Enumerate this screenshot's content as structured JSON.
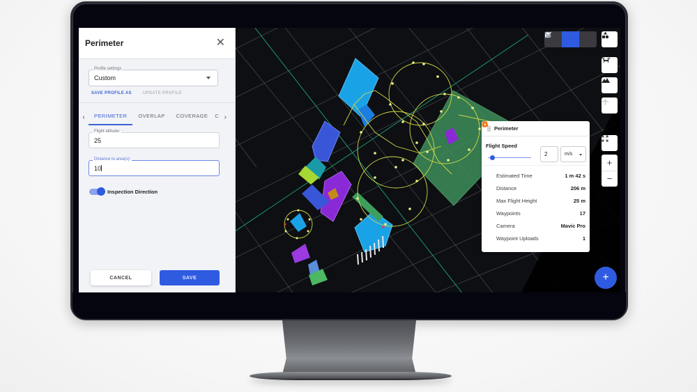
{
  "left_panel": {
    "title": "Perimeter",
    "close_icon": "close-icon",
    "profile": {
      "label": "Profile settings",
      "value": "Custom",
      "save_as": "SAVE PROFILE AS",
      "update": "UPDATE PROFILE"
    },
    "tabs": [
      {
        "label": "PERIMETER",
        "active": true
      },
      {
        "label": "OVERLAP",
        "active": false
      },
      {
        "label": "COVERAGE",
        "active": false
      },
      {
        "label": "C",
        "active": false
      }
    ],
    "fields": {
      "altitude": {
        "label": "Flight altitude:",
        "value": "25"
      },
      "distance": {
        "label": "Distance to area(s):",
        "value": "10"
      }
    },
    "toggle": {
      "label": "Inspection Direction",
      "on": true
    },
    "buttons": {
      "cancel": "CANCEL",
      "save": "SAVE"
    }
  },
  "map": {
    "view_modes": [
      {
        "name": "2d-map",
        "icon": "map-icon",
        "active": false
      },
      {
        "name": "3d",
        "icon": "cube-icon",
        "active": true
      },
      {
        "name": "terrain-off",
        "icon": "slash-terrain-icon",
        "active": false
      }
    ],
    "side_buttons": [
      "shapes-icon",
      "drone-icon",
      "mountain-icon",
      "airplane-icon"
    ],
    "zoom": {
      "in": "+",
      "out": "−"
    },
    "fab": "+",
    "accent_color": "#2f5be0"
  },
  "stats_card": {
    "title": "Perimeter",
    "flight_speed": {
      "label": "Flight Speed",
      "value": "2",
      "unit": "m/s",
      "slider_fraction": 0.1
    },
    "stats": [
      {
        "icon": "clock-icon",
        "label": "Estimated Time",
        "value": "1 m 42 s"
      },
      {
        "icon": "navigation-arrow-icon",
        "label": "Distance",
        "value": "206 m"
      },
      {
        "icon": "height-icon",
        "label": "Max Flight Height",
        "value": "25 m"
      },
      {
        "icon": "map-pin-icon",
        "label": "Waypoints",
        "value": "17"
      },
      {
        "icon": "camera-icon",
        "label": "Camera",
        "value": "Mavic Pro"
      },
      {
        "icon": "cloud-upload-icon",
        "label": "Waypoint Uploads",
        "value": "1"
      }
    ],
    "icon_color": "#f07c1e"
  }
}
